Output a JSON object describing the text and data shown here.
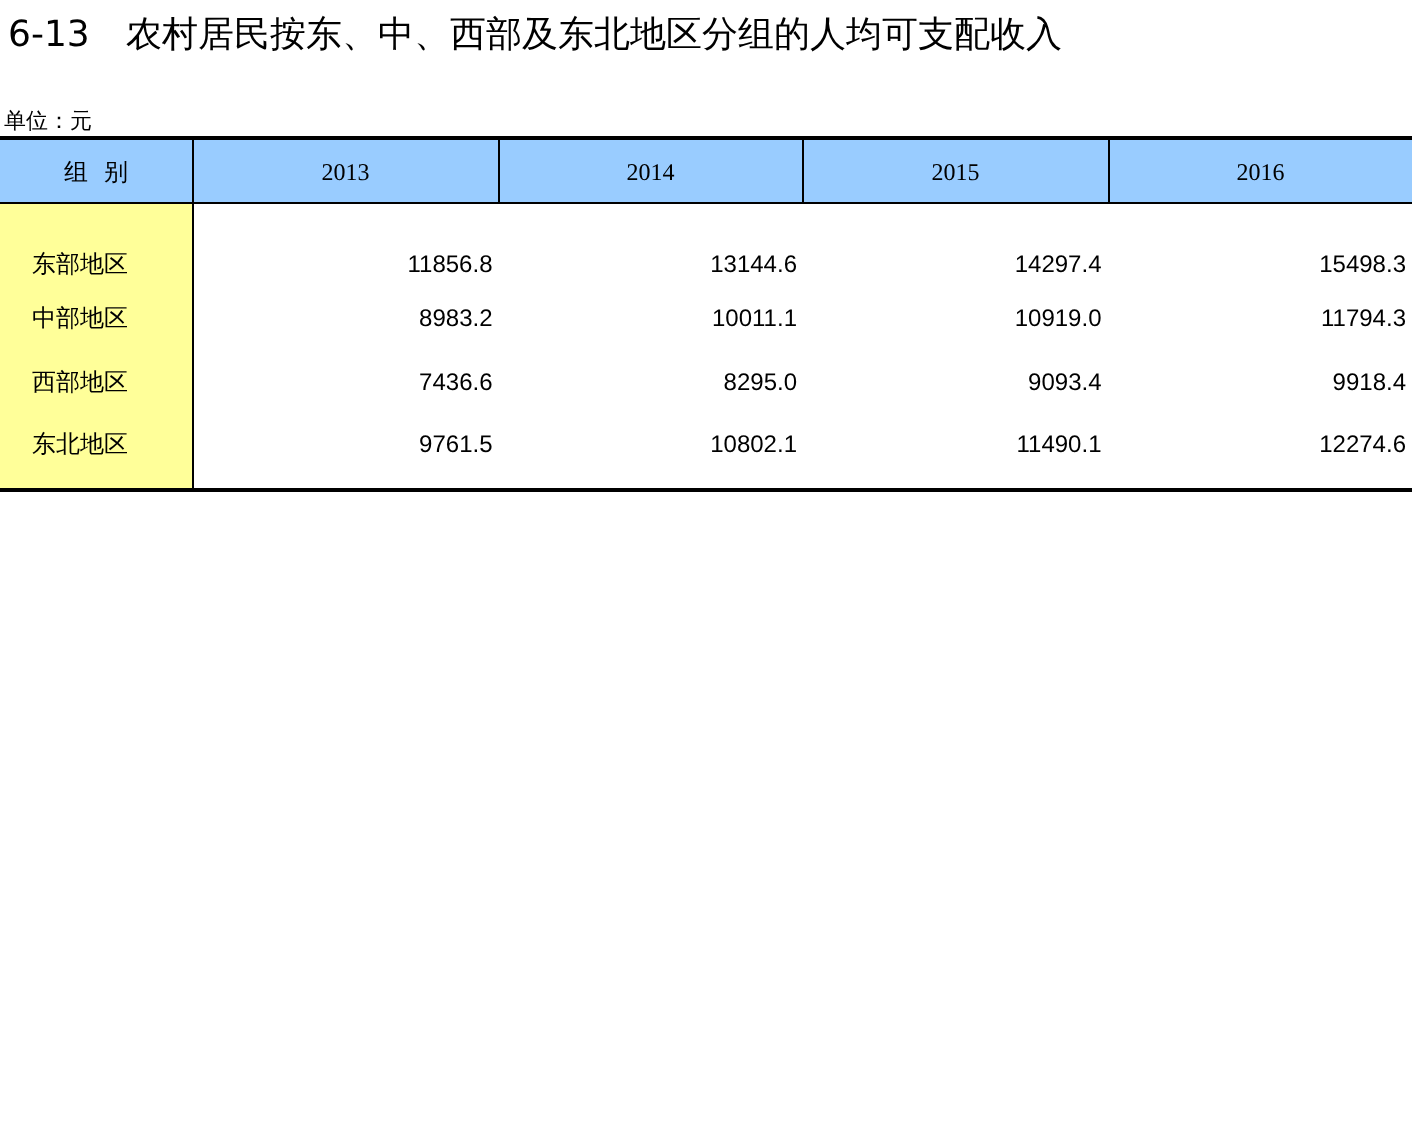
{
  "title": "6-13　农村居民按东、中、西部及东北地区分组的人均可支配收入",
  "unit": "单位：元",
  "table": {
    "columns": [
      "组  别",
      "2013",
      "2014",
      "2015",
      "2016"
    ],
    "rows": [
      {
        "label": "东部地区",
        "values": [
          "11856.8",
          "13144.6",
          "14297.4",
          "15498.3"
        ]
      },
      {
        "label": "中部地区",
        "values": [
          "8983.2",
          "10011.1",
          "10919.0",
          "11794.3"
        ]
      },
      {
        "label": "西部地区",
        "values": [
          "7436.6",
          "8295.0",
          "9093.4",
          "9918.4"
        ]
      },
      {
        "label": "东北地区",
        "values": [
          "9761.5",
          "10802.1",
          "11490.1",
          "12274.6"
        ]
      }
    ]
  }
}
